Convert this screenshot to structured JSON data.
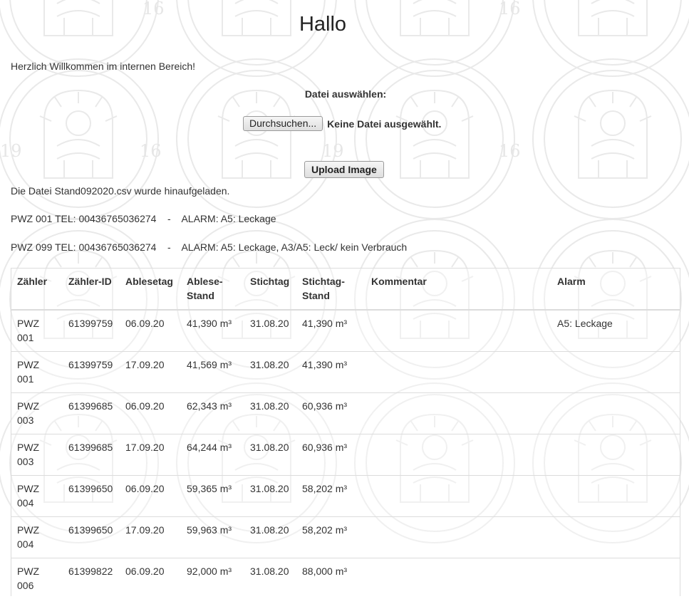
{
  "page": {
    "title": "Hallo",
    "welcome": "Herzlich Willkommen im internen Bereich!",
    "file_label": "Datei auswählen:",
    "browse_button": "Durchsuchen...",
    "no_file_text": "Keine Datei ausgewählt.",
    "upload_button": "Upload Image",
    "uploaded_message": "Die Datei Stand092020.csv wurde hinaufgeladen.",
    "alarm_lines": [
      "PWZ 001 TEL: 00436765036274    -    ALARM: A5: Leckage",
      "PWZ 099 TEL: 00436765036274    -    ALARM: A5: Leckage, A3/A5: Leck/ kein Verbrauch"
    ]
  },
  "table": {
    "headers": [
      "Zähler",
      "Zähler-ID",
      "Ablesetag",
      "Ablese-Stand",
      "Stichtag",
      "Stichtag-Stand",
      "Kommentar",
      "Alarm"
    ],
    "rows": [
      [
        "PWZ 001",
        "61399759",
        "06.09.20",
        "41,390 m³",
        "31.08.20",
        "41,390 m³",
        "",
        "A5: Leckage"
      ],
      [
        "PWZ 001",
        "61399759",
        "17.09.20",
        "41,569 m³",
        "31.08.20",
        "41,390 m³",
        "",
        ""
      ],
      [
        "PWZ 003",
        "61399685",
        "06.09.20",
        "62,343 m³",
        "31.08.20",
        "60,936 m³",
        "",
        ""
      ],
      [
        "PWZ 003",
        "61399685",
        "17.09.20",
        "64,244 m³",
        "31.08.20",
        "60,936 m³",
        "",
        ""
      ],
      [
        "PWZ 004",
        "61399650",
        "06.09.20",
        "59,365 m³",
        "31.08.20",
        "58,202 m³",
        "",
        ""
      ],
      [
        "PWZ 004",
        "61399650",
        "17.09.20",
        "59,963 m³",
        "31.08.20",
        "58,202 m³",
        "",
        ""
      ],
      [
        "PWZ 006",
        "61399822",
        "06.09.20",
        "92,000 m³",
        "31.08.20",
        "88,000 m³",
        "",
        ""
      ]
    ]
  },
  "watermark": {
    "text_19": "19",
    "text_16": "16",
    "color": "#ececec"
  }
}
